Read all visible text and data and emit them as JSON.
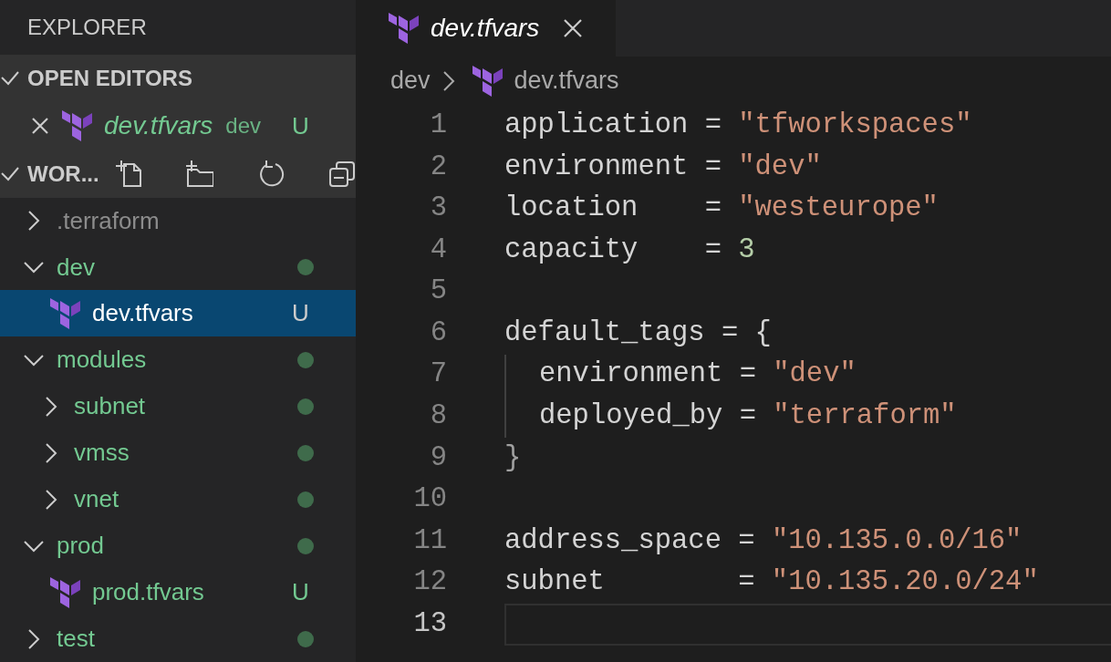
{
  "sidebar": {
    "title": "EXPLORER",
    "open_editors": {
      "title": "OPEN EDITORS",
      "expanded": true,
      "items": [
        {
          "name": "dev.tfvars",
          "folder": "dev",
          "badge": "U"
        }
      ]
    },
    "workspace": {
      "title": "WOR...",
      "expanded": true,
      "tree": [
        {
          "name": ".terraform",
          "kind": "folder",
          "expanded": false,
          "selected": false,
          "ignored": true
        },
        {
          "name": "dev",
          "kind": "folder",
          "expanded": true,
          "selected": false,
          "ignored": false,
          "children": [
            {
              "name": "dev.tfvars",
              "kind": "file",
              "selected": true,
              "ignored": false,
              "badge": "U"
            }
          ]
        },
        {
          "name": "modules",
          "kind": "folder",
          "expanded": true,
          "selected": false,
          "ignored": false,
          "children": [
            {
              "name": "subnet",
              "kind": "folder",
              "expanded": false,
              "selected": false,
              "ignored": false
            },
            {
              "name": "vmss",
              "kind": "folder",
              "expanded": false,
              "selected": false,
              "ignored": false
            },
            {
              "name": "vnet",
              "kind": "folder",
              "expanded": false,
              "selected": false,
              "ignored": false
            }
          ]
        },
        {
          "name": "prod",
          "kind": "folder",
          "expanded": true,
          "selected": false,
          "ignored": false,
          "children": [
            {
              "name": "prod.tfvars",
              "kind": "file",
              "selected": false,
              "ignored": false,
              "badge": "U"
            }
          ]
        },
        {
          "name": "test",
          "kind": "folder",
          "expanded": false,
          "selected": false,
          "ignored": false
        }
      ]
    }
  },
  "tabs": [
    {
      "label": "dev.tfvars",
      "selected": true
    }
  ],
  "breadcrumb": [
    "dev",
    "dev.tfvars"
  ],
  "editor": {
    "lines": [
      {
        "number": "1",
        "indent": false,
        "current": false,
        "tokens": [
          {
            "kind": "key",
            "text": "application"
          },
          {
            "kind": "op",
            "text": " = "
          },
          {
            "kind": "str",
            "text": "\"tfworkspaces\""
          }
        ]
      },
      {
        "number": "2",
        "indent": false,
        "current": false,
        "tokens": [
          {
            "kind": "key",
            "text": "environment"
          },
          {
            "kind": "op",
            "text": " = "
          },
          {
            "kind": "str",
            "text": "\"dev\""
          }
        ]
      },
      {
        "number": "3",
        "indent": false,
        "current": false,
        "tokens": [
          {
            "kind": "key",
            "text": "location"
          },
          {
            "kind": "op",
            "text": "    = "
          },
          {
            "kind": "str",
            "text": "\"westeurope\""
          }
        ]
      },
      {
        "number": "4",
        "indent": false,
        "current": false,
        "tokens": [
          {
            "kind": "key",
            "text": "capacity"
          },
          {
            "kind": "op",
            "text": "    = "
          },
          {
            "kind": "num",
            "text": "3"
          }
        ]
      },
      {
        "number": "5",
        "indent": false,
        "current": false
      },
      {
        "number": "6",
        "indent": false,
        "current": false,
        "tokens": [
          {
            "kind": "key",
            "text": "default_tags"
          },
          {
            "kind": "op",
            "text": " = {"
          }
        ]
      },
      {
        "number": "7",
        "indent": true,
        "current": false,
        "tokens": [
          {
            "kind": "key",
            "text": "environment"
          },
          {
            "kind": "op",
            "text": " = "
          },
          {
            "kind": "str",
            "text": "\"dev\""
          }
        ]
      },
      {
        "number": "8",
        "indent": true,
        "current": false,
        "tokens": [
          {
            "kind": "key",
            "text": "deployed_by"
          },
          {
            "kind": "op",
            "text": " = "
          },
          {
            "kind": "str",
            "text": "\"terraform\""
          }
        ]
      },
      {
        "number": "9",
        "indent": false,
        "current": false,
        "tokens": [
          {
            "kind": "brace",
            "text": "}"
          }
        ]
      },
      {
        "number": "10",
        "indent": false,
        "current": false
      },
      {
        "number": "11",
        "indent": false,
        "current": false,
        "tokens": [
          {
            "kind": "key",
            "text": "address_space"
          },
          {
            "kind": "op",
            "text": " = "
          },
          {
            "kind": "str",
            "text": "\"10.135.0.0/16\""
          }
        ]
      },
      {
        "number": "12",
        "indent": false,
        "current": false,
        "tokens": [
          {
            "kind": "key",
            "text": "subnet"
          },
          {
            "kind": "op",
            "text": "        = "
          },
          {
            "kind": "str",
            "text": "\"10.135.20.0/24\""
          }
        ]
      },
      {
        "number": "13",
        "indent": false,
        "current": true
      }
    ]
  }
}
